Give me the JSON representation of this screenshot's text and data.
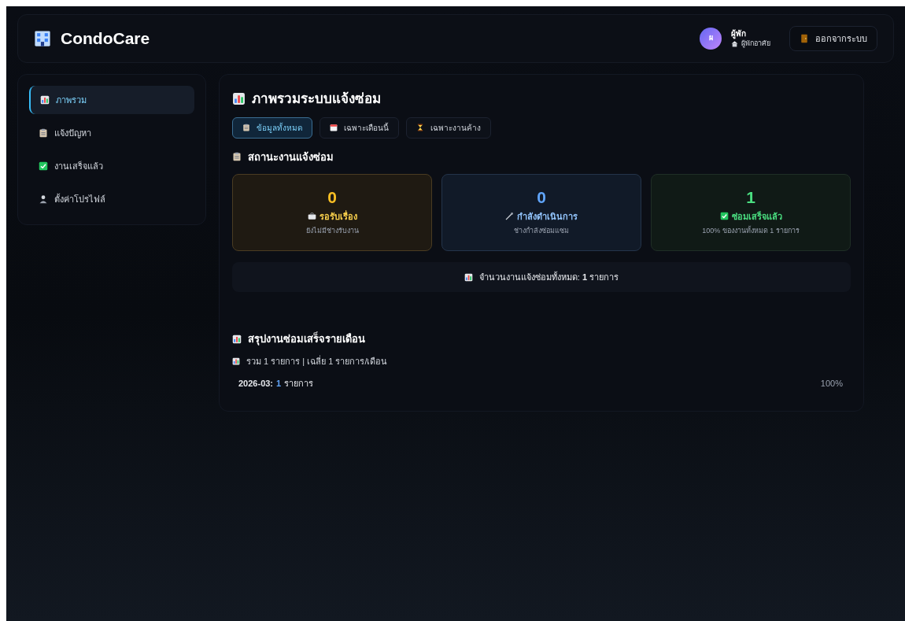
{
  "header": {
    "brand": "CondoCare",
    "user": {
      "avatar": "ผ",
      "name": "ผู้พัก",
      "role": "ผู้พักอาศัย"
    },
    "logout": "ออกจากระบบ"
  },
  "sidebar": {
    "items": [
      {
        "label": "ภาพรวม",
        "selected": true
      },
      {
        "label": "แจ้งปัญหา",
        "selected": false
      },
      {
        "label": "งานเสร็จแล้ว",
        "selected": false
      },
      {
        "label": "ตั้งค่าโปรไฟล์",
        "selected": false
      }
    ]
  },
  "main": {
    "title": "ภาพรวมระบบแจ้งซ่อม",
    "filters": [
      {
        "label": "ข้อมูลทั้งหมด",
        "selected": true
      },
      {
        "label": "เฉพาะเดือนนี้",
        "selected": false
      },
      {
        "label": "เฉพาะงานค้าง",
        "selected": false
      }
    ],
    "status_heading": "สถานะงานแจ้งซ่อม",
    "stats": [
      {
        "kind": "pending",
        "count": "0",
        "label": "รอรับเรื่อง",
        "note": "ยังไม่มีช่างรับงาน"
      },
      {
        "kind": "progress",
        "count": "0",
        "label": "กำลังดำเนินการ",
        "note": "ช่างกำลังซ่อมแซม"
      },
      {
        "kind": "done",
        "count": "1",
        "label": "ซ่อมเสร็จแล้ว",
        "note": "100% ของงานทั้งหมด 1 รายการ"
      }
    ],
    "total": "จำนวนงานแจ้งซ่อมทั้งหมด: **1** รายการ",
    "monthly": {
      "heading": "สรุปงานซ่อมเสร็จรายเดือน",
      "summary": "รวม 1 รายการ | เฉลี่ย 1 รายการ/เดือน",
      "rows": [
        {
          "month": "2026-03:",
          "count": "1",
          "unit": "รายการ",
          "percent": "100%"
        }
      ]
    }
  }
}
